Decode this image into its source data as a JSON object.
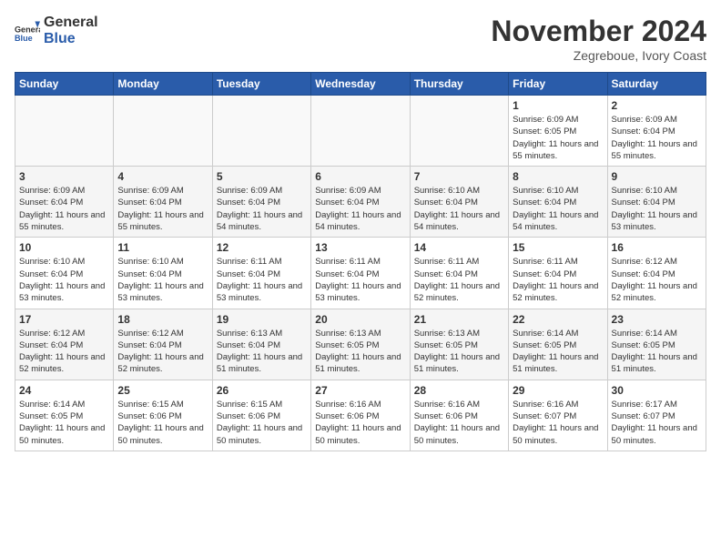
{
  "header": {
    "logo_line1": "General",
    "logo_line2": "Blue",
    "month_year": "November 2024",
    "location": "Zegreboue, Ivory Coast"
  },
  "days_of_week": [
    "Sunday",
    "Monday",
    "Tuesday",
    "Wednesday",
    "Thursday",
    "Friday",
    "Saturday"
  ],
  "weeks": [
    {
      "days": [
        {
          "num": "",
          "empty": true
        },
        {
          "num": "",
          "empty": true
        },
        {
          "num": "",
          "empty": true
        },
        {
          "num": "",
          "empty": true
        },
        {
          "num": "",
          "empty": true
        },
        {
          "num": "1",
          "sunrise": "6:09 AM",
          "sunset": "6:05 PM",
          "daylight": "11 hours and 55 minutes."
        },
        {
          "num": "2",
          "sunrise": "6:09 AM",
          "sunset": "6:04 PM",
          "daylight": "11 hours and 55 minutes."
        }
      ]
    },
    {
      "days": [
        {
          "num": "3",
          "sunrise": "6:09 AM",
          "sunset": "6:04 PM",
          "daylight": "11 hours and 55 minutes."
        },
        {
          "num": "4",
          "sunrise": "6:09 AM",
          "sunset": "6:04 PM",
          "daylight": "11 hours and 55 minutes."
        },
        {
          "num": "5",
          "sunrise": "6:09 AM",
          "sunset": "6:04 PM",
          "daylight": "11 hours and 54 minutes."
        },
        {
          "num": "6",
          "sunrise": "6:09 AM",
          "sunset": "6:04 PM",
          "daylight": "11 hours and 54 minutes."
        },
        {
          "num": "7",
          "sunrise": "6:10 AM",
          "sunset": "6:04 PM",
          "daylight": "11 hours and 54 minutes."
        },
        {
          "num": "8",
          "sunrise": "6:10 AM",
          "sunset": "6:04 PM",
          "daylight": "11 hours and 54 minutes."
        },
        {
          "num": "9",
          "sunrise": "6:10 AM",
          "sunset": "6:04 PM",
          "daylight": "11 hours and 53 minutes."
        }
      ]
    },
    {
      "days": [
        {
          "num": "10",
          "sunrise": "6:10 AM",
          "sunset": "6:04 PM",
          "daylight": "11 hours and 53 minutes."
        },
        {
          "num": "11",
          "sunrise": "6:10 AM",
          "sunset": "6:04 PM",
          "daylight": "11 hours and 53 minutes."
        },
        {
          "num": "12",
          "sunrise": "6:11 AM",
          "sunset": "6:04 PM",
          "daylight": "11 hours and 53 minutes."
        },
        {
          "num": "13",
          "sunrise": "6:11 AM",
          "sunset": "6:04 PM",
          "daylight": "11 hours and 53 minutes."
        },
        {
          "num": "14",
          "sunrise": "6:11 AM",
          "sunset": "6:04 PM",
          "daylight": "11 hours and 52 minutes."
        },
        {
          "num": "15",
          "sunrise": "6:11 AM",
          "sunset": "6:04 PM",
          "daylight": "11 hours and 52 minutes."
        },
        {
          "num": "16",
          "sunrise": "6:12 AM",
          "sunset": "6:04 PM",
          "daylight": "11 hours and 52 minutes."
        }
      ]
    },
    {
      "days": [
        {
          "num": "17",
          "sunrise": "6:12 AM",
          "sunset": "6:04 PM",
          "daylight": "11 hours and 52 minutes."
        },
        {
          "num": "18",
          "sunrise": "6:12 AM",
          "sunset": "6:04 PM",
          "daylight": "11 hours and 52 minutes."
        },
        {
          "num": "19",
          "sunrise": "6:13 AM",
          "sunset": "6:04 PM",
          "daylight": "11 hours and 51 minutes."
        },
        {
          "num": "20",
          "sunrise": "6:13 AM",
          "sunset": "6:05 PM",
          "daylight": "11 hours and 51 minutes."
        },
        {
          "num": "21",
          "sunrise": "6:13 AM",
          "sunset": "6:05 PM",
          "daylight": "11 hours and 51 minutes."
        },
        {
          "num": "22",
          "sunrise": "6:14 AM",
          "sunset": "6:05 PM",
          "daylight": "11 hours and 51 minutes."
        },
        {
          "num": "23",
          "sunrise": "6:14 AM",
          "sunset": "6:05 PM",
          "daylight": "11 hours and 51 minutes."
        }
      ]
    },
    {
      "days": [
        {
          "num": "24",
          "sunrise": "6:14 AM",
          "sunset": "6:05 PM",
          "daylight": "11 hours and 50 minutes."
        },
        {
          "num": "25",
          "sunrise": "6:15 AM",
          "sunset": "6:06 PM",
          "daylight": "11 hours and 50 minutes."
        },
        {
          "num": "26",
          "sunrise": "6:15 AM",
          "sunset": "6:06 PM",
          "daylight": "11 hours and 50 minutes."
        },
        {
          "num": "27",
          "sunrise": "6:16 AM",
          "sunset": "6:06 PM",
          "daylight": "11 hours and 50 minutes."
        },
        {
          "num": "28",
          "sunrise": "6:16 AM",
          "sunset": "6:06 PM",
          "daylight": "11 hours and 50 minutes."
        },
        {
          "num": "29",
          "sunrise": "6:16 AM",
          "sunset": "6:07 PM",
          "daylight": "11 hours and 50 minutes."
        },
        {
          "num": "30",
          "sunrise": "6:17 AM",
          "sunset": "6:07 PM",
          "daylight": "11 hours and 50 minutes."
        }
      ]
    }
  ]
}
